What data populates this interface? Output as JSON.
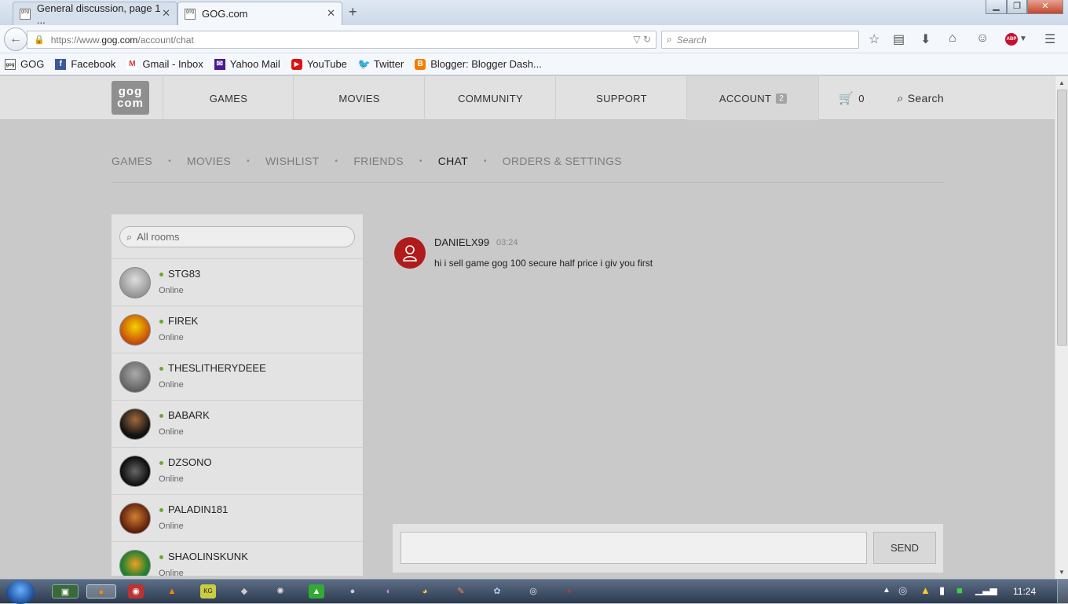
{
  "browser": {
    "tabs": [
      {
        "title": "General discussion, page 1 ...",
        "active": false
      },
      {
        "title": "GOG.com",
        "active": true
      }
    ],
    "url": {
      "prefix": "https://www.",
      "host": "gog.com",
      "path": "/account/chat"
    },
    "search_placeholder": "Search",
    "bookmarks": [
      "GOG",
      "Facebook",
      "Gmail - Inbox",
      "Yahoo Mail",
      "YouTube",
      "Twitter",
      "Blogger: Blogger Dash..."
    ],
    "abp_label": "ABP"
  },
  "site": {
    "logo_line1": "gog",
    "logo_line2": "com",
    "topnav": {
      "games": "GAMES",
      "movies": "MOVIES",
      "community": "COMMUNITY",
      "support": "SUPPORT",
      "account": "ACCOUNT",
      "account_badge": "2",
      "cart_count": "0",
      "search": "Search"
    },
    "subnav": {
      "games": "GAMES",
      "movies": "MOVIES",
      "wishlist": "WISHLIST",
      "friends": "FRIENDS",
      "chat": "CHAT",
      "orders": "ORDERS & SETTINGS",
      "sep": "•"
    }
  },
  "rooms": {
    "search_placeholder": "All rooms",
    "items": [
      {
        "name": "STG83",
        "status": "Online"
      },
      {
        "name": "FIREK",
        "status": "Online"
      },
      {
        "name": "THESLITHERYDEEE",
        "status": "Online"
      },
      {
        "name": "BABARK",
        "status": "Online"
      },
      {
        "name": "DZSONO",
        "status": "Online"
      },
      {
        "name": "PALADIN181",
        "status": "Online"
      },
      {
        "name": "SHAOLINSKUNK",
        "status": "Online"
      }
    ]
  },
  "chat": {
    "message": {
      "user": "DANIELX99",
      "time": "03:24",
      "text": "hi i sell game gog 100 secure half price i giv you first"
    },
    "send_label": "SEND"
  },
  "taskbar": {
    "clock": "11:24"
  },
  "colors": {
    "accent_red": "#b01c1c",
    "online_green": "#6fa52e"
  }
}
